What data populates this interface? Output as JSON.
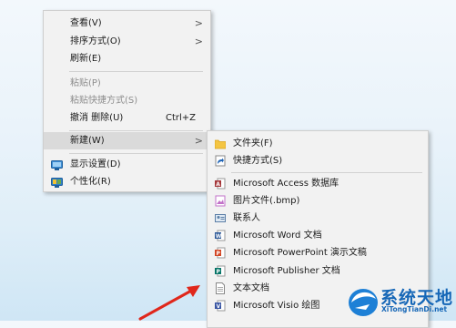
{
  "context_menu": {
    "items": [
      {
        "label": "查看(V)"
      },
      {
        "label": "排序方式(O)"
      },
      {
        "label": "刷新(E)"
      },
      {
        "label": "粘贴(P)"
      },
      {
        "label": "粘贴快捷方式(S)"
      },
      {
        "label": "撤消 删除(U)",
        "shortcut": "Ctrl+Z"
      },
      {
        "label": "新建(W)"
      },
      {
        "label": "显示设置(D)",
        "icon": "display-icon"
      },
      {
        "label": "个性化(R)",
        "icon": "personalize-icon"
      }
    ],
    "submenu_chevron": ">"
  },
  "new_submenu": {
    "items": [
      {
        "label": "文件夹(F)",
        "icon": "folder-icon"
      },
      {
        "label": "快捷方式(S)",
        "icon": "shortcut-icon"
      },
      {
        "label": "Microsoft Access 数据库",
        "icon": "access-icon"
      },
      {
        "label": "图片文件(.bmp)",
        "icon": "bmp-icon"
      },
      {
        "label": "联系人",
        "icon": "contact-icon"
      },
      {
        "label": "Microsoft Word 文档",
        "icon": "word-icon"
      },
      {
        "label": "Microsoft PowerPoint 演示文稿",
        "icon": "powerpoint-icon"
      },
      {
        "label": "Microsoft Publisher 文档",
        "icon": "publisher-icon"
      },
      {
        "label": "文本文档",
        "icon": "text-document-icon"
      },
      {
        "label": "Microsoft Visio 绘图",
        "icon": "visio-icon"
      }
    ]
  },
  "watermark": {
    "title": "系统天地",
    "url": "XiTongTianDi.net"
  },
  "colors": {
    "menu_bg": "#f2f2f2",
    "highlight": "#dadada",
    "disabled": "#8d8d8d",
    "arrow": "#e0271b",
    "brand": "#1667b7"
  }
}
